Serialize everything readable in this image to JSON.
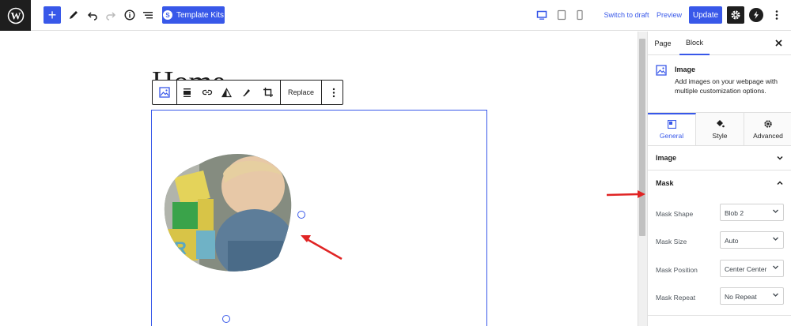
{
  "toolbar": {
    "add_label": "+",
    "template_kits_label": "Template Kits",
    "template_kits_badge": "S",
    "switch_to_draft_label": "Switch to draft",
    "preview_label": "Preview",
    "update_label": "Update"
  },
  "editor": {
    "page_title": "Home",
    "block_toolbar": {
      "replace_label": "Replace"
    },
    "image_alt": "Toddler playing with letter blocks"
  },
  "sidebar": {
    "tabs": [
      "Page",
      "Block"
    ],
    "active_tab": "Block",
    "block_card": {
      "title": "Image",
      "description": "Add images on your webpage with multiple customization options."
    },
    "control_tabs": [
      "General",
      "Style",
      "Advanced"
    ],
    "active_control_tab": "General",
    "panels": {
      "image": "Image",
      "mask": "Mask"
    },
    "mask_fields": [
      {
        "label": "Mask Shape",
        "value": "Blob 2"
      },
      {
        "label": "Mask Size",
        "value": "Auto"
      },
      {
        "label": "Mask Position",
        "value": "Center Center"
      },
      {
        "label": "Mask Repeat",
        "value": "No Repeat"
      }
    ]
  },
  "colors": {
    "accent": "#3858e9",
    "dark": "#1e1e1e",
    "annotation": "#e02424"
  }
}
